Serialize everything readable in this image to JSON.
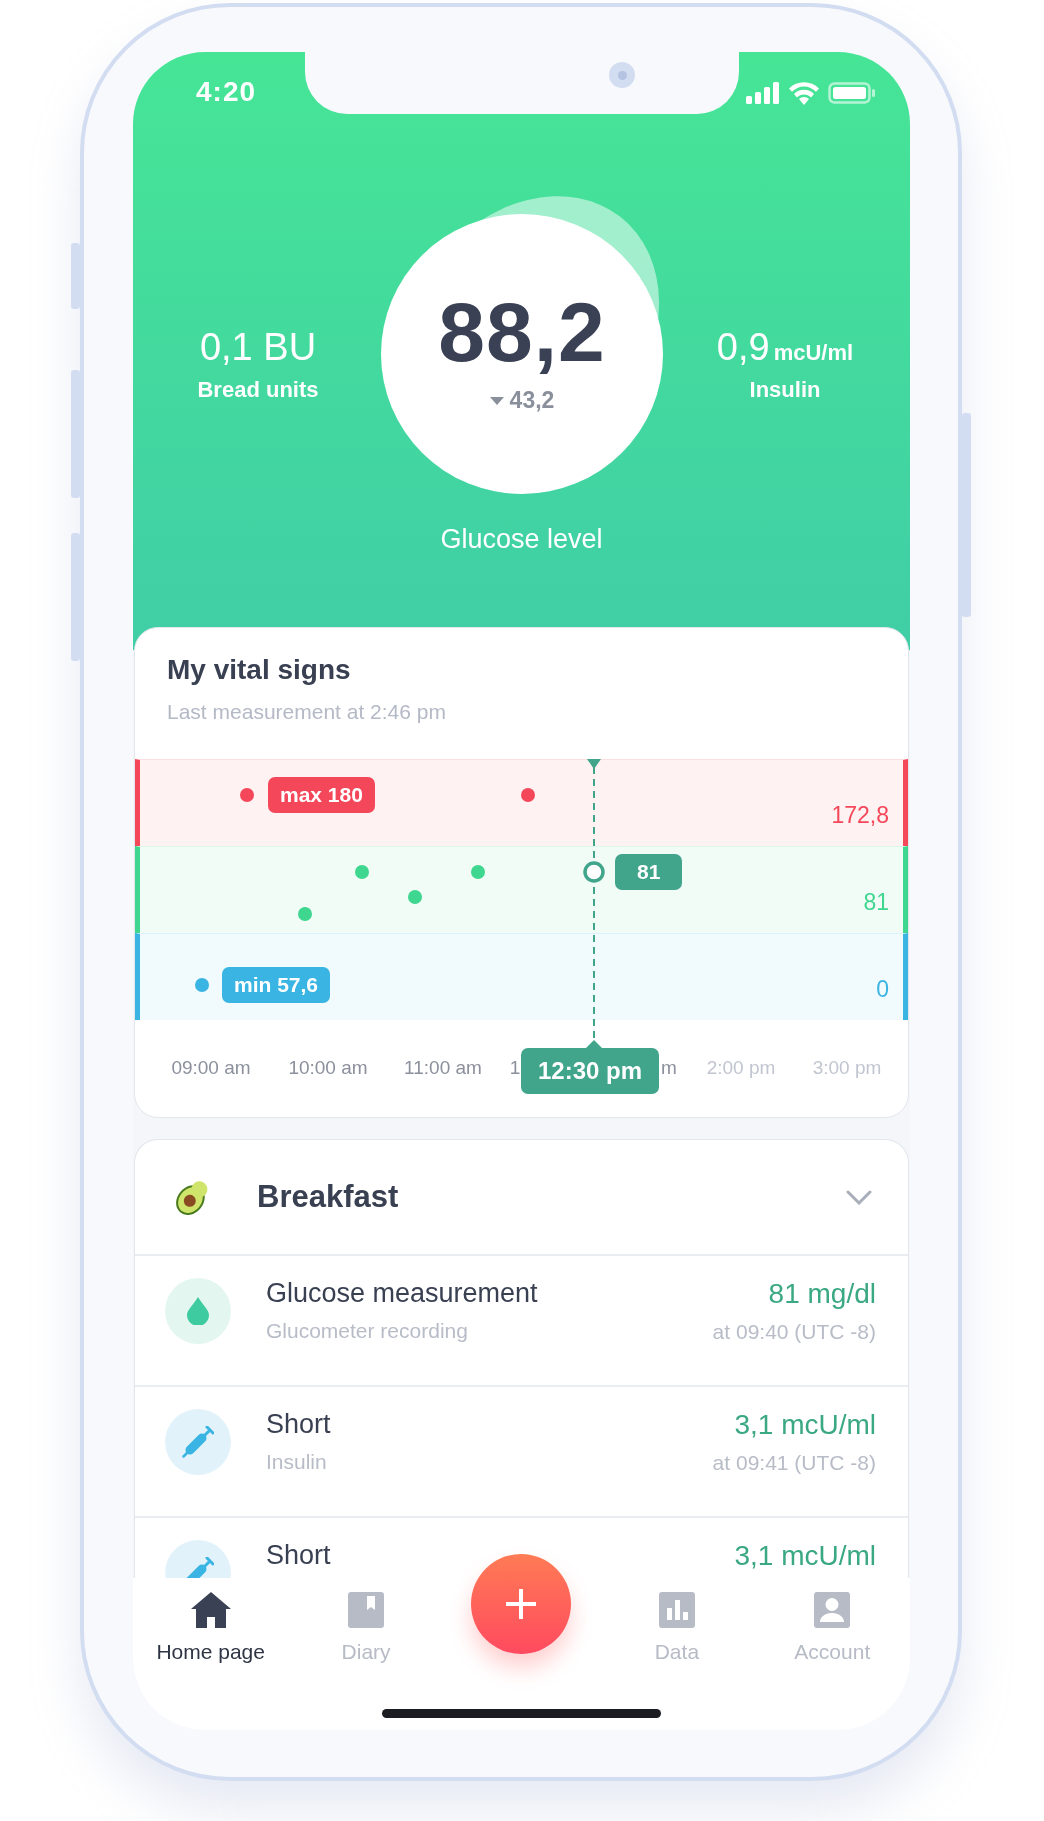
{
  "status_bar": {
    "time": "4:20"
  },
  "summary": {
    "bread_units": {
      "value": "0,1 BU",
      "label": "Bread units"
    },
    "glucose": {
      "value": "88,2",
      "falling": true,
      "change": "43,2",
      "label": "Glucose level"
    },
    "insulin": {
      "value": "0,9",
      "unit": "mcU/ml",
      "label": "Insulin"
    }
  },
  "vital_signs": {
    "title": "My vital signs",
    "subtitle": "Last measurement at 2:46 pm",
    "bands": [
      {
        "color": "#f5475a",
        "badge": "max 180",
        "value": "172,8"
      },
      {
        "color": "#3fd68f",
        "value": "81"
      },
      {
        "color": "#3ab5e3",
        "badge": "min 57,6",
        "value": "0"
      }
    ],
    "cursor": {
      "value": "81",
      "time": "12:30 pm"
    },
    "time_labels": [
      {
        "text": "09:00 am",
        "past": true
      },
      {
        "text": "10:00 am",
        "past": true
      },
      {
        "text": "11:00 am",
        "past": true
      },
      {
        "text": "1",
        "past": true
      },
      {
        "text": "m",
        "past": true
      },
      {
        "text": "2:00 pm",
        "past": false
      },
      {
        "text": "3:00 pm",
        "past": false
      }
    ]
  },
  "meal": {
    "title": "Breakfast",
    "entries": [
      {
        "kind": "glucose",
        "title": "Glucose measurement",
        "subtitle": "Glucometer recording",
        "value": "81 mg/dl",
        "time": "at 09:40 (UTC -8)"
      },
      {
        "kind": "insulin",
        "title": "Short",
        "subtitle": "Insulin",
        "value": "3,1 mcU/ml",
        "time": "at 09:41 (UTC -8)"
      },
      {
        "kind": "insulin",
        "title": "Short",
        "value": "3,1 mcU/ml"
      }
    ]
  },
  "tabs": [
    {
      "kind": "home",
      "label": "Home page",
      "selected": true
    },
    {
      "kind": "diary",
      "label": "Diary",
      "selected": false
    },
    {
      "kind": "add"
    },
    {
      "kind": "data",
      "label": "Data",
      "selected": false
    },
    {
      "kind": "account",
      "label": "Account",
      "selected": false
    }
  ]
}
